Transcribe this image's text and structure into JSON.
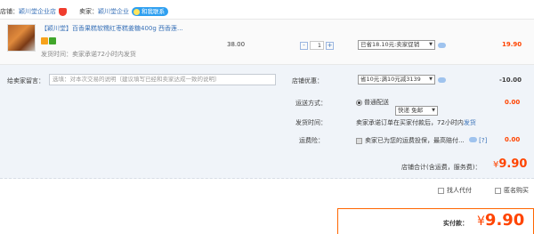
{
  "shop": {
    "label": "店铺：",
    "name": "颖川堂企业店",
    "seller_label": "卖家：",
    "seller_name": "颖川堂企业",
    "contact_badge": "和我联系"
  },
  "product": {
    "title": "【颖川堂】百香果糕软糯红枣糕姜糖400g 西香莲...",
    "delivery": "发货时间：卖家承诺72小时内发货",
    "price": "38.00",
    "quantity": "1",
    "qty_minus": "-",
    "qty_plus": "+",
    "discount_select": "已省18.10元:卖家促销",
    "subtotal": "19.90",
    "tag_colors": [
      "#f7a21c",
      "#41a62b"
    ]
  },
  "message": {
    "label": "给卖家留言：",
    "placeholder": "选填：对本次交易的说明（建议填写已经和卖家达成一致的说明）"
  },
  "shop_discount": {
    "label": "店铺优惠：",
    "select": "省10元:满10元减3139",
    "amount": "-10.00"
  },
  "shipping": {
    "label": "运送方式：",
    "radio_label": "普通配送",
    "select": "快递 免邮",
    "amount": "0.00"
  },
  "ship_time": {
    "label": "发货时间：",
    "text": "卖家承诺订单在买家付款后，72小时内",
    "link": "发货"
  },
  "insurance": {
    "label": "运费险：",
    "text": "卖家已为您的运费投保，最高赔付...",
    "help": "[?]",
    "amount": "0.00"
  },
  "shop_total": {
    "label": "店铺合计(含运费，服务费)：",
    "currency": "¥",
    "amount": "9.90"
  },
  "extras": {
    "proxy_pay": "找人代付",
    "anonymous": "匿名购买"
  },
  "pay": {
    "label": "实付款：",
    "currency": "¥",
    "amount": "9.90"
  }
}
